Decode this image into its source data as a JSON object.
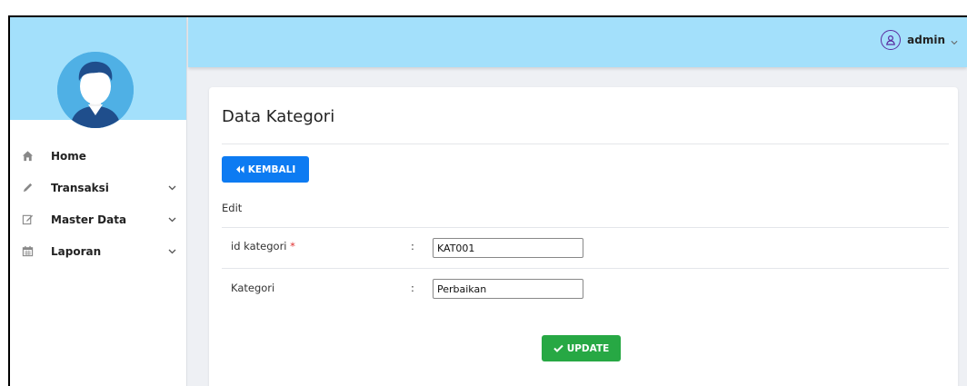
{
  "header": {
    "username": "admin"
  },
  "sidebar": {
    "items": [
      {
        "label": "Home",
        "icon": "home-icon",
        "has_submenu": false
      },
      {
        "label": "Transaksi",
        "icon": "pencil-icon",
        "has_submenu": true
      },
      {
        "label": "Master Data",
        "icon": "edit-icon",
        "has_submenu": true
      },
      {
        "label": "Laporan",
        "icon": "calendar-icon",
        "has_submenu": true
      }
    ]
  },
  "main": {
    "title": "Data Kategori",
    "back_button": "KEMBALI",
    "section_label": "Edit",
    "form": {
      "id_kategori": {
        "label": "id kategori",
        "required_mark": "*",
        "colon": ":",
        "value": "KAT001"
      },
      "kategori": {
        "label": "Kategori",
        "colon": ":",
        "value": "Perbaikan"
      }
    },
    "update_button": "UPDATE"
  },
  "colors": {
    "topbar": "#a3e0fb",
    "primary": "#0d7bf2",
    "success": "#27a844",
    "required": "#e03131"
  }
}
